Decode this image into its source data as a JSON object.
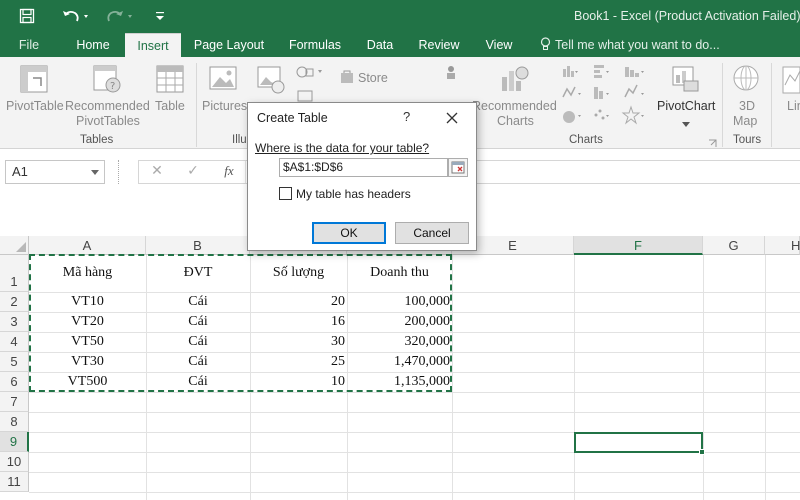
{
  "window": {
    "title": "Book1 - Excel (Product Activation Failed)"
  },
  "qat": {
    "save_icon": "save-icon",
    "undo_icon": "undo-icon",
    "redo_icon": "redo-icon",
    "customize_icon": "customize-qat-icon"
  },
  "tabs": [
    {
      "label": "File"
    },
    {
      "label": "Home"
    },
    {
      "label": "Insert",
      "active": true
    },
    {
      "label": "Page Layout"
    },
    {
      "label": "Formulas"
    },
    {
      "label": "Data"
    },
    {
      "label": "Review"
    },
    {
      "label": "View"
    }
  ],
  "tellme": {
    "placeholder": "Tell me what you want to do..."
  },
  "ribbon": {
    "pivottable": "PivotTable",
    "recommended_pivottables_1": "Recommended",
    "recommended_pivottables_2": "PivotTables",
    "table": "Table",
    "pictures": "Pictures",
    "store": "Store",
    "recommended_charts_1": "Recommended",
    "recommended_charts_2": "Charts",
    "pivotchart": "PivotChart",
    "map3d_1": "3D",
    "map3d_2": "Map",
    "line_partial": "Lin",
    "groups": {
      "tables": "Tables",
      "illustrations_partial": "Illu",
      "charts": "Charts",
      "tours": "Tours"
    }
  },
  "formula_bar": {
    "name_box": "A1",
    "cancel": "✕",
    "enter": "✓",
    "fx": "fx"
  },
  "grid": {
    "columns": [
      "A",
      "B",
      "C",
      "D",
      "E",
      "F",
      "G",
      "H"
    ],
    "selected_column": "F",
    "rows": [
      "1",
      "2",
      "3",
      "4",
      "5",
      "6",
      "7",
      "8",
      "9",
      "10",
      "11"
    ],
    "selected_row": "9",
    "header": [
      "Mã hàng",
      "ĐVT",
      "Số lượng",
      "Doanh thu"
    ],
    "data": [
      [
        "VT10",
        "Cái",
        "20",
        "100,000"
      ],
      [
        "VT20",
        "Cái",
        "16",
        "200,000"
      ],
      [
        "VT50",
        "Cái",
        "30",
        "320,000"
      ],
      [
        "VT30",
        "Cái",
        "25",
        "1,470,000"
      ],
      [
        "VT500",
        "Cái",
        "10",
        "1,135,000"
      ]
    ]
  },
  "dialog": {
    "title": "Create Table",
    "help": "?",
    "prompt": "Where is the data for your table?",
    "range": "$A$1:$D$6",
    "checkbox_label": "My table has headers",
    "checkbox_checked": false,
    "ok": "OK",
    "cancel": "Cancel"
  },
  "colors": {
    "accent": "#217346",
    "ribbon_bg": "#f3f3f3",
    "marquee": "#217346"
  }
}
